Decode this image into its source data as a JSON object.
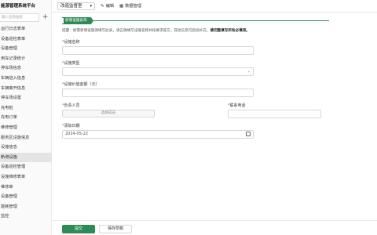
{
  "sidebar": {
    "title": "能源管理系统平台",
    "search_placeholder": "输入名称搜索",
    "add_label": "+",
    "items": [
      {
        "label": "运行日志表单"
      },
      {
        "label": "设备巡检表单"
      },
      {
        "label": "设备管理"
      },
      {
        "label": "用车记录统计"
      },
      {
        "label": "停车场信息"
      },
      {
        "label": "车辆进入信息"
      },
      {
        "label": "车辆离开信息"
      },
      {
        "label": "停车场设置"
      },
      {
        "label": "充电桩"
      },
      {
        "label": "充电订单"
      },
      {
        "label": "维修管理"
      },
      {
        "label": "服务区设施信息"
      },
      {
        "label": "设施信息"
      },
      {
        "label": "新增设施",
        "active": true
      },
      {
        "label": "设备巡检管理"
      },
      {
        "label": "设施维修表单"
      },
      {
        "label": "维修单"
      },
      {
        "label": "设备管理"
      },
      {
        "label": "能耗管理"
      },
      {
        "label": "监控"
      }
    ]
  },
  "topbar": {
    "select_value": "改造监督室",
    "edit_label": "编辑",
    "data_manage_label": "数据管理"
  },
  "main": {
    "tab_label": "新增设施表单",
    "notice": "提醒：如需新增设施请填写此表，请正确填写设施名称并按要求提交，其他信息可后续补充，",
    "notice_highlight": "请完整填写所有必填项。",
    "fields": {
      "name": {
        "label": "设施名称",
        "value": ""
      },
      "type": {
        "label": "设施类型",
        "value": ""
      },
      "price": {
        "label": "设施价值金额（元）",
        "value": ""
      },
      "owner": {
        "label": "负责人员",
        "button": "选择成员"
      },
      "phone": {
        "label": "联系电话",
        "value": ""
      },
      "date": {
        "label": "添加日期",
        "value": "2024-05-22"
      }
    },
    "submit_label": "提交",
    "save_draft_label": "保存草稿"
  }
}
